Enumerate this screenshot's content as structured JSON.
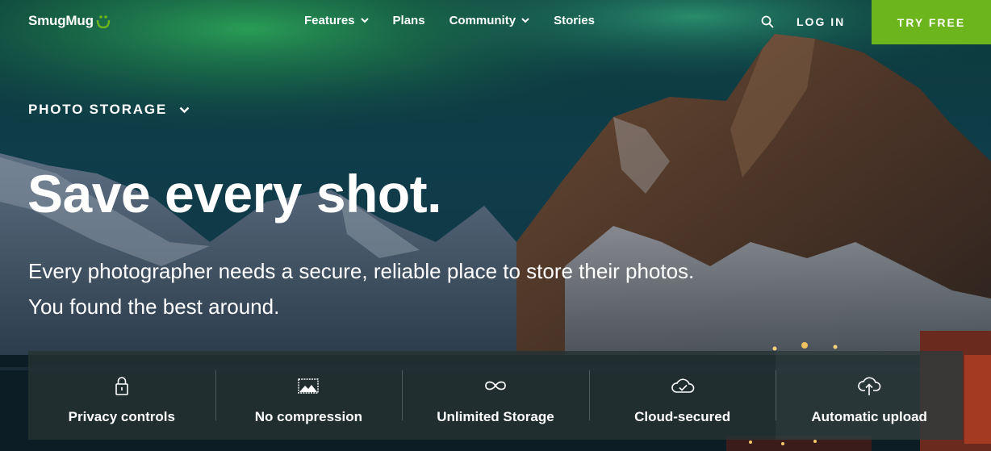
{
  "brand": {
    "name": "SmugMug",
    "accent": "#6cb51c"
  },
  "nav": {
    "items": [
      {
        "label": "Features",
        "has_dropdown": true
      },
      {
        "label": "Plans",
        "has_dropdown": false
      },
      {
        "label": "Community",
        "has_dropdown": true
      },
      {
        "label": "Stories",
        "has_dropdown": false
      }
    ],
    "search_icon": "search-icon",
    "login": "LOG IN",
    "cta": "TRY FREE"
  },
  "hero": {
    "section": "PHOTO STORAGE",
    "headline": "Save every shot.",
    "subline": "Every photographer needs a secure, reliable place to store their photos. You found the best around."
  },
  "features": [
    {
      "icon": "lock-icon",
      "label": "Privacy controls"
    },
    {
      "icon": "image-icon",
      "label": "No compression"
    },
    {
      "icon": "infinity-icon",
      "label": "Unlimited Storage"
    },
    {
      "icon": "cloud-check-icon",
      "label": "Cloud-secured"
    },
    {
      "icon": "cloud-upload-icon",
      "label": "Automatic upload"
    }
  ]
}
